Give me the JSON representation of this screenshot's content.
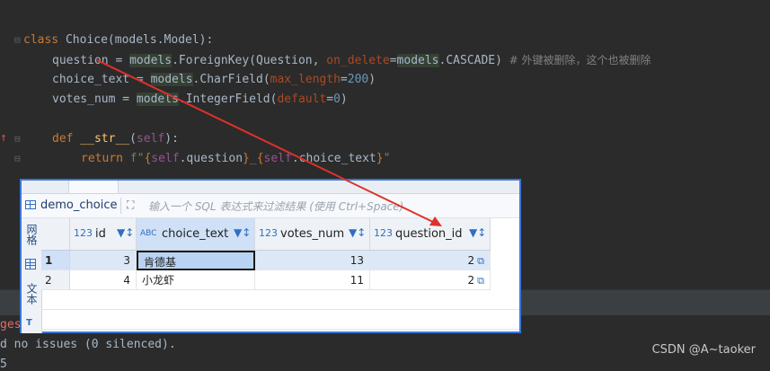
{
  "code": {
    "line1": {
      "kw": "class",
      "name": " Choice(models.Model):"
    },
    "line2": {
      "a": "question",
      "b": " = ",
      "c": "models",
      "d": ".ForeignKey(Question, ",
      "e": "on_delete",
      "f": "=",
      "g": "models",
      "h": ".CASCADE)",
      "comment": "  # 外键被删除，这个也被删除"
    },
    "line3": {
      "a": "choice_text = ",
      "b": "models",
      "c": ".CharField(",
      "d": "max_length",
      "e": "=",
      "f": "200",
      "g": ")"
    },
    "line4": {
      "a": "votes_num = ",
      "b": "models",
      "c": ".IntegerField(",
      "d": "default",
      "e": "=",
      "f": "0",
      "g": ")"
    },
    "line5": {
      "kw": "def",
      "fn": " __str__",
      "p1": "(",
      "self": "self",
      "p2": "):"
    },
    "line6": {
      "kw": "return",
      "f": " f\"",
      "o1": "{",
      "s1": "self",
      "a1": ".question",
      "c1": "}",
      "u": "_",
      "o2": "{",
      "s2": "self",
      "a2": ".choice_text",
      "c2": "}",
      "q": "\""
    }
  },
  "panel": {
    "table_name": "demo_choice",
    "filter_placeholder": "输入一个 SQL 表达式来过滤结果 (使用 Ctrl+Space)",
    "side_tabs": [
      "网格",
      "文本"
    ],
    "columns": [
      {
        "type": "123",
        "name": "id"
      },
      {
        "type": "ABC",
        "name": "choice_text"
      },
      {
        "type": "123",
        "name": "votes_num"
      },
      {
        "type": "123",
        "name": "question_id"
      }
    ],
    "rows": [
      {
        "num": "1",
        "id": "3",
        "choice_text": "肯德基",
        "votes_num": "13",
        "question_id": "2"
      },
      {
        "num": "2",
        "id": "4",
        "choice_text": "小龙虾",
        "votes_num": "11",
        "question_id": "2"
      }
    ]
  },
  "console": {
    "line1": "ges",
    "line2": "d no issues (0 silenced).",
    "line3": "5"
  },
  "watermark": "CSDN @A~taoker",
  "colors": {
    "arrow": "#e0302a",
    "accent": "#3a77d8"
  }
}
